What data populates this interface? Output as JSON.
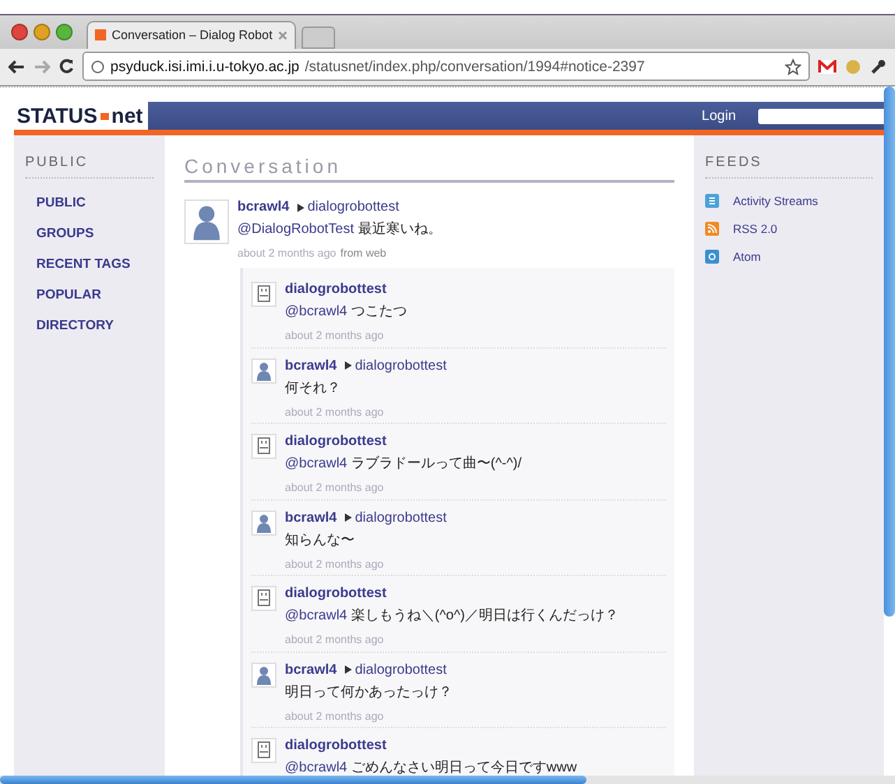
{
  "browser": {
    "tab_title": "Conversation – Dialog Robot",
    "url_host": "psyduck.isi.imi.i.u-tokyo.ac.jp",
    "url_path": "/statusnet/index.php/conversation/1994#notice-2397"
  },
  "header": {
    "logo_left": "STATUS",
    "logo_right": "net",
    "login": "Login"
  },
  "sidebar": {
    "heading": "PUBLIC",
    "items": [
      {
        "label": "PUBLIC"
      },
      {
        "label": "GROUPS"
      },
      {
        "label": "RECENT TAGS"
      },
      {
        "label": "POPULAR"
      },
      {
        "label": "DIRECTORY"
      }
    ]
  },
  "main": {
    "title": "Conversation",
    "notice": {
      "kind": "user",
      "author": "bcrawl4",
      "recipient": "dialogrobottest",
      "mention": "@DialogRobotTest",
      "text": "最近寒いね。",
      "time": "about 2 months ago",
      "source": "from web"
    },
    "replies": [
      {
        "kind": "bot",
        "author": "dialogrobottest",
        "mention": "@bcrawl4",
        "text": "つこたつ",
        "time": "about 2 months ago"
      },
      {
        "kind": "user",
        "author": "bcrawl4",
        "recipient": "dialogrobottest",
        "text": "何それ？",
        "time": "about 2 months ago"
      },
      {
        "kind": "bot",
        "author": "dialogrobottest",
        "mention": "@bcrawl4",
        "text": "ラブラドールって曲〜(^-^)/",
        "time": "about 2 months ago"
      },
      {
        "kind": "user",
        "author": "bcrawl4",
        "recipient": "dialogrobottest",
        "text": "知らんな〜",
        "time": "about 2 months ago"
      },
      {
        "kind": "bot",
        "author": "dialogrobottest",
        "mention": "@bcrawl4",
        "text": "楽しもうね＼(^o^)／明日は行くんだっけ？",
        "time": "about 2 months ago"
      },
      {
        "kind": "user",
        "author": "bcrawl4",
        "recipient": "dialogrobottest",
        "text": "明日って何かあったっけ？",
        "time": "about 2 months ago"
      },
      {
        "kind": "bot",
        "author": "dialogrobottest",
        "mention": "@bcrawl4",
        "text": "ごめんなさい明日って今日ですwww"
      }
    ]
  },
  "feeds": {
    "heading": "FEEDS",
    "items": [
      {
        "label": "Activity Streams",
        "kind": "activity"
      },
      {
        "label": "RSS 2.0",
        "kind": "rss"
      },
      {
        "label": "Atom",
        "kind": "atom"
      }
    ]
  }
}
